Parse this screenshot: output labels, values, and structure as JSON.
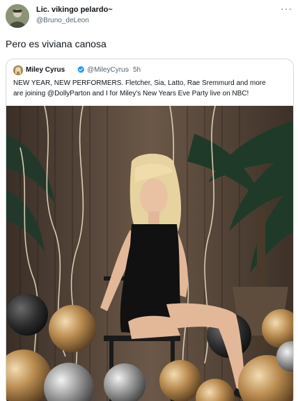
{
  "tweet": {
    "author_name": "Lic. vikingo pelardo~",
    "author_handle": "@Bruno_deLeon",
    "more_icon": "more-horizontal-icon",
    "more_glyph": "···",
    "text": "Pero es viviana canosa"
  },
  "quote": {
    "author_name": "Miley Cyrus",
    "verified_icon": "verified-badge-icon",
    "author_handle": "@MileyCyrus",
    "separator": "·",
    "time": "5h",
    "text_line1": "NEW YEAR, NEW PERFORMERS. Fletcher, Sia, Latto, Rae Sremmurd and more",
    "text_line2": "are joining @DollyParton and I for Miley's New Years Eve Party live on NBC!"
  },
  "colors": {
    "primary_text": "#0f1419",
    "secondary_text": "#536471",
    "border": "#cfd9de",
    "verified_blue": "#1d9bf0"
  }
}
